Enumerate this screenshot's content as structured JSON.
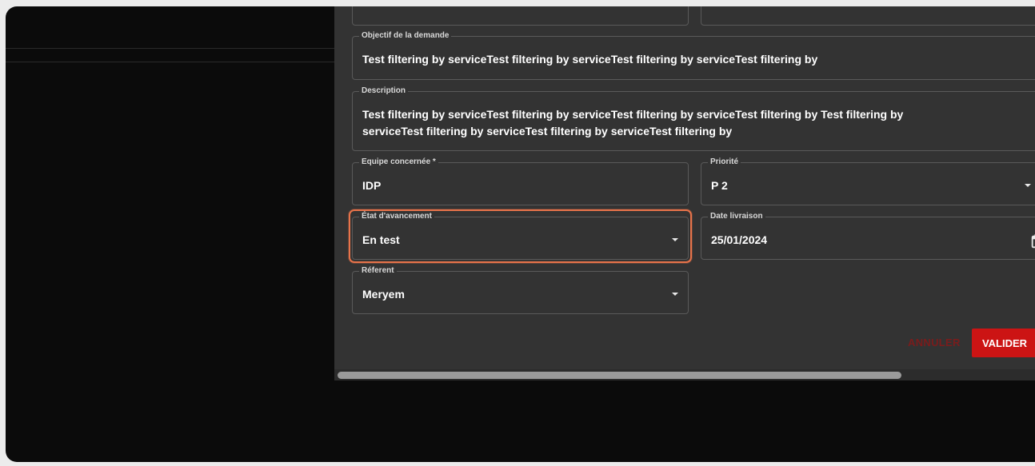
{
  "form": {
    "objectif": {
      "label": "Objectif de la demande",
      "value": "Test filtering by serviceTest filtering by serviceTest filtering by serviceTest filtering by"
    },
    "description": {
      "label": "Description",
      "line1": "Test filtering by serviceTest filtering by serviceTest filtering by serviceTest filtering by  Test filtering by",
      "line2": "serviceTest filtering by serviceTest filtering by serviceTest filtering by"
    },
    "equipe": {
      "label": "Equipe concernée *",
      "value": "IDP"
    },
    "priorite": {
      "label": "Priorité",
      "value": "P 2"
    },
    "etat": {
      "label": "État d'avancement",
      "value": "En test"
    },
    "date_livraison": {
      "label": "Date livraison",
      "value": "25/01/2024"
    },
    "referent": {
      "label": "Réferent",
      "value": "Meryem"
    }
  },
  "actions": {
    "cancel_label": "ANNULER",
    "validate_label": "VALIDER"
  },
  "colors": {
    "accent": "#cc1414",
    "highlight": "#e8734a",
    "dialog_bg": "#333333",
    "page_bg": "#0b0b0b"
  },
  "icons": {
    "select_caret": "chevron-down-icon",
    "date_picker": "calendar-icon"
  }
}
